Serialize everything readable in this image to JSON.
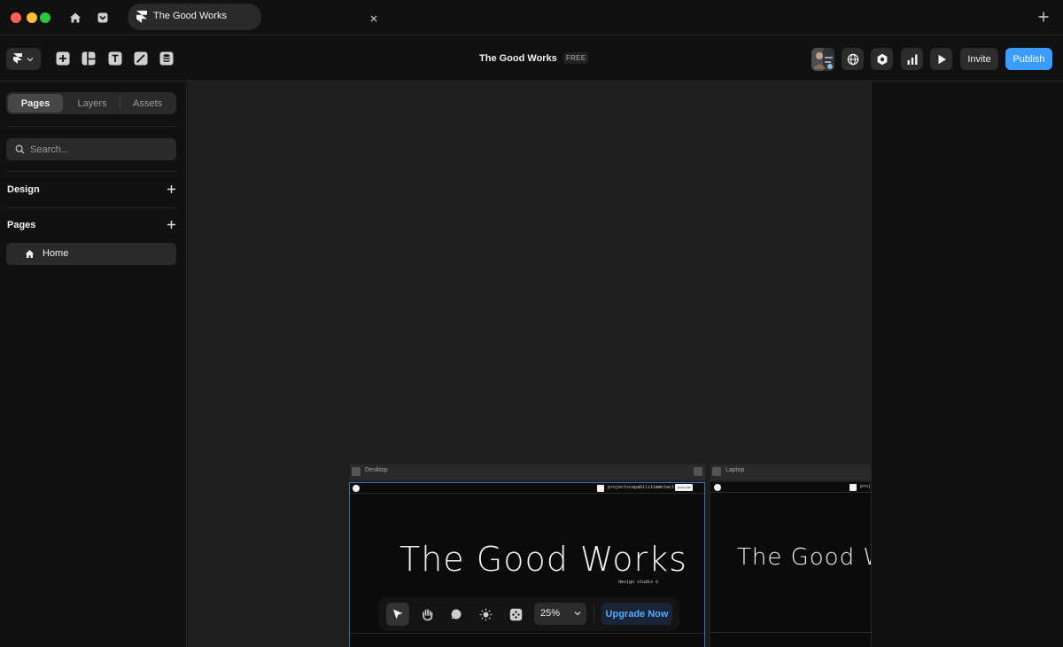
{
  "tab": {
    "title": "The Good Works"
  },
  "project": {
    "title": "The Good Works",
    "plan_badge": "FREE"
  },
  "header": {
    "invite_label": "Invite",
    "publish_label": "Publish"
  },
  "sidebar": {
    "tabs": [
      {
        "label": "Pages",
        "active": true
      },
      {
        "label": "Layers",
        "active": false
      },
      {
        "label": "Assets",
        "active": false
      }
    ],
    "search": {
      "placeholder": "Search..."
    },
    "sections": {
      "design": "Design",
      "pages": "Pages"
    },
    "pages": [
      {
        "label": "Home",
        "icon": "home-icon"
      }
    ]
  },
  "canvas": {
    "frames": [
      {
        "label": "Desktop",
        "nav": {
          "links": [
            "projects",
            "capabilities",
            "contact"
          ],
          "cta": "book a call"
        },
        "hero": "The Good Works",
        "subtitle": "design studio ©"
      },
      {
        "label": "Laptop",
        "nav": {
          "links": [
            "projects"
          ]
        },
        "hero": "The Good Works"
      }
    ]
  },
  "bottom_toolbar": {
    "tools": [
      "select-tool",
      "hand-tool",
      "comment-tool",
      "theme-toggle",
      "components-tool"
    ],
    "zoom": "25%",
    "upgrade_label": "Upgrade Now"
  },
  "colors": {
    "accent": "#3b9cff",
    "upgrade_text": "#5aa7ff",
    "canvas_bg": "#1e1e1e",
    "panel_bg": "#111111"
  }
}
